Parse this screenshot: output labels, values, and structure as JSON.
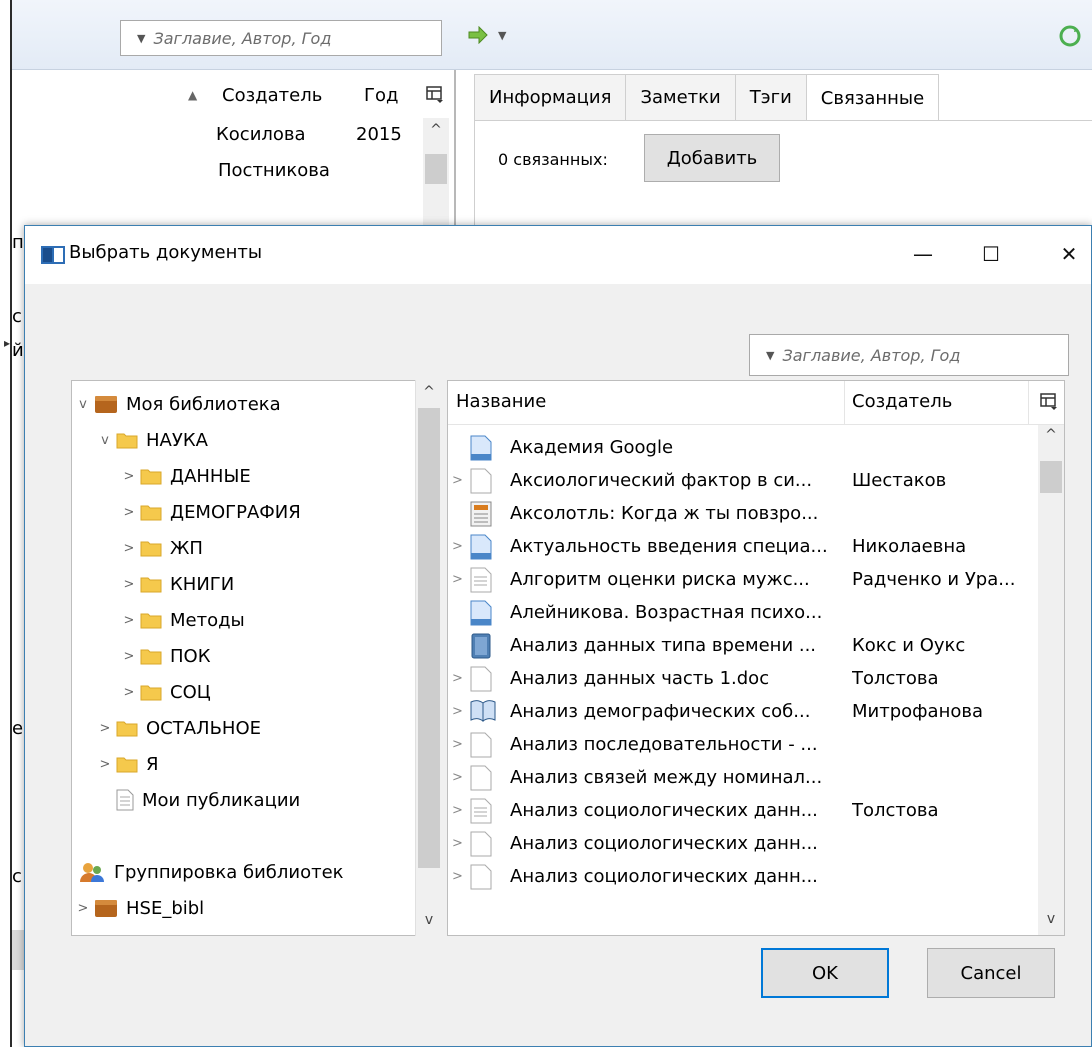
{
  "main_window": {
    "search_placeholder": "Заглавие, Автор, Год",
    "columns": {
      "creator": "Создатель",
      "year": "Год"
    },
    "rows": [
      {
        "creator": "Косилова",
        "year": "2015"
      },
      {
        "creator": "Постникова",
        "year": ""
      }
    ],
    "tabs": [
      {
        "label": "Информация"
      },
      {
        "label": "Заметки"
      },
      {
        "label": "Тэги"
      },
      {
        "label": "Связанные"
      }
    ],
    "related_count": "0 связанных:",
    "add_button": "Добавить",
    "edge_fragments": [
      "п",
      "с",
      "й",
      "е",
      "с"
    ]
  },
  "dialog": {
    "title": "Выбрать документы",
    "search_placeholder": "Заглавие, Автор, Год",
    "tree": [
      {
        "label": "Моя библиотека",
        "icon": "library-icon",
        "twisty": "v"
      },
      {
        "label": "НАУКА",
        "icon": "folder-icon",
        "twisty": "v"
      },
      {
        "label": "ДАННЫЕ",
        "icon": "folder-icon",
        "twisty": ">"
      },
      {
        "label": "ДЕМОГРАФИЯ",
        "icon": "folder-icon",
        "twisty": ">"
      },
      {
        "label": "ЖП",
        "icon": "folder-icon",
        "twisty": ">"
      },
      {
        "label": "КНИГИ",
        "icon": "folder-icon",
        "twisty": ">"
      },
      {
        "label": "Методы",
        "icon": "folder-icon",
        "twisty": ">"
      },
      {
        "label": "ПОК",
        "icon": "folder-icon",
        "twisty": ">"
      },
      {
        "label": "СОЦ",
        "icon": "folder-icon",
        "twisty": ">"
      },
      {
        "label": "ОСТАЛЬНОЕ",
        "icon": "folder-icon",
        "twisty": ">"
      },
      {
        "label": "Я",
        "icon": "folder-icon",
        "twisty": ">"
      },
      {
        "label": "Мои публикации",
        "icon": "publications-icon",
        "twisty": ""
      },
      {
        "label": "Группировка библиотек",
        "icon": "group-icon",
        "twisty": ""
      },
      {
        "label": "HSE_bibl",
        "icon": "library-icon",
        "twisty": ">"
      }
    ],
    "columns": {
      "title": "Название",
      "creator": "Создатель"
    },
    "items": [
      {
        "title": "Академия Google",
        "creator": "",
        "icon": "webpage-icon",
        "has_children": false
      },
      {
        "title": "Аксиологический фактор в си...",
        "creator": "Шестаков",
        "icon": "document-icon",
        "has_children": true
      },
      {
        "title": "Аксолотль: Когда ж ты повзро...",
        "creator": "",
        "icon": "newspaper-icon",
        "has_children": false
      },
      {
        "title": "Актуальность введения специа...",
        "creator": "Николаевна",
        "icon": "webpage-icon",
        "has_children": true
      },
      {
        "title": "Алгоритм оценки риска мужс...",
        "creator": "Радченко и Ура...",
        "icon": "report-icon",
        "has_children": true
      },
      {
        "title": "Алейникова. Возрастная психо...",
        "creator": "",
        "icon": "webpage-icon",
        "has_children": false
      },
      {
        "title": "Анализ данных типа времени ...",
        "creator": "Кокс и Оукс",
        "icon": "book-icon",
        "has_children": false
      },
      {
        "title": "Анализ данных часть 1.doc",
        "creator": "Толстова",
        "icon": "document-icon",
        "has_children": true
      },
      {
        "title": "Анализ демографических соб...",
        "creator": "Митрофанова",
        "icon": "book-section-icon",
        "has_children": true
      },
      {
        "title": "Анализ последовательности - ...",
        "creator": "",
        "icon": "document-icon",
        "has_children": true
      },
      {
        "title": "Анализ связей между номинал...",
        "creator": "",
        "icon": "document-icon",
        "has_children": true
      },
      {
        "title": "Анализ социологических данн...",
        "creator": "Толстова",
        "icon": "report-icon",
        "has_children": true
      },
      {
        "title": "Анализ социологических данн...",
        "creator": "",
        "icon": "document-icon",
        "has_children": true
      },
      {
        "title": "Анализ социологических данн...",
        "creator": "",
        "icon": "document-icon",
        "has_children": true
      }
    ],
    "ok_button": "OK",
    "cancel_button": "Cancel"
  },
  "colors": {
    "accent": "#0078d7",
    "folder": "#f5c94c",
    "library": "#b5651d"
  }
}
